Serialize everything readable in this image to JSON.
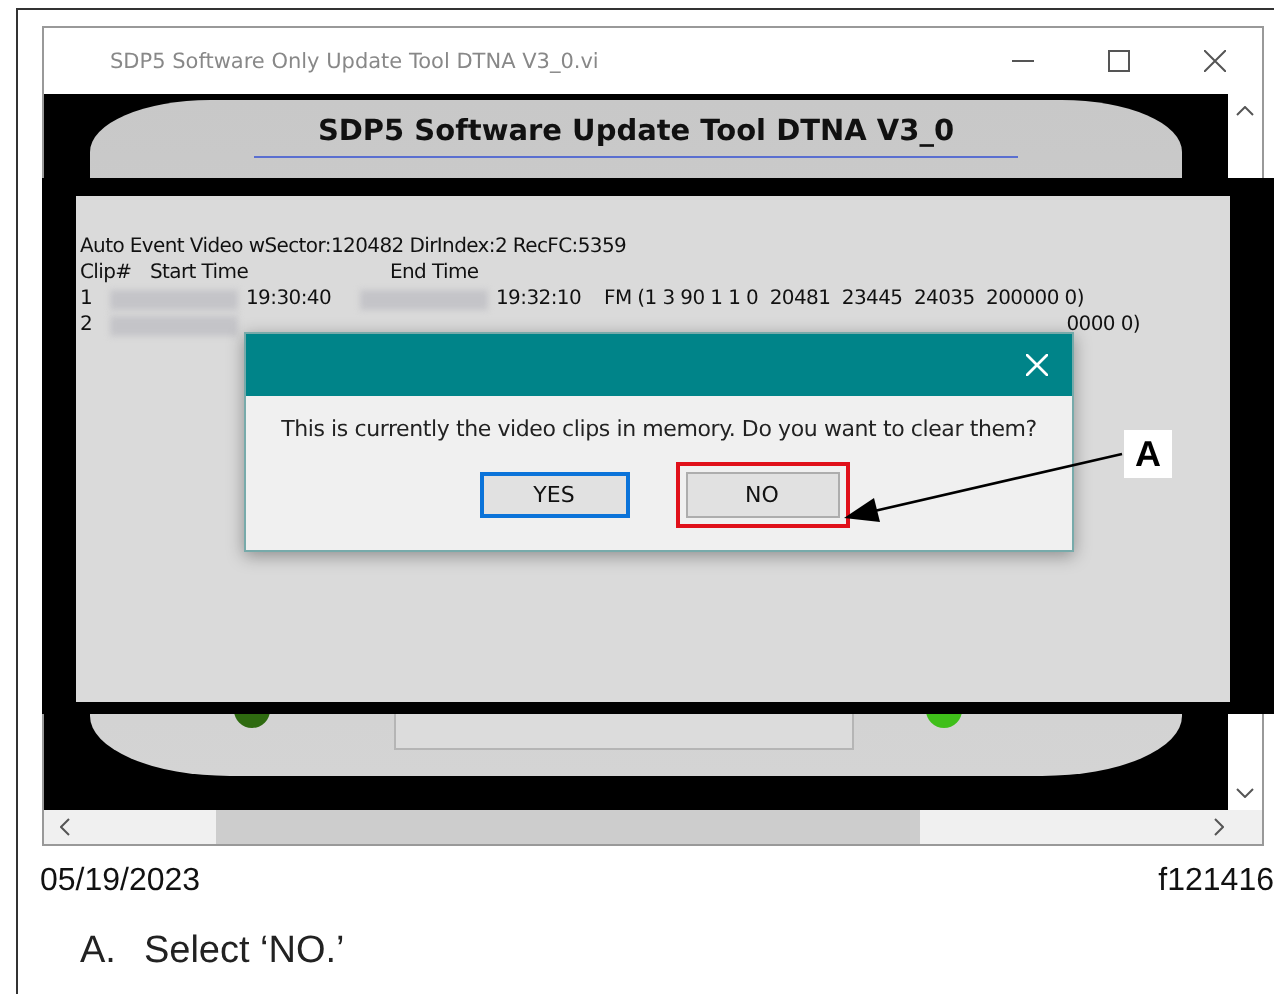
{
  "window": {
    "title": "SDP5 Software Only Update Tool DTNA V3_0.vi"
  },
  "app": {
    "heading": "SDP5 Software Update Tool DTNA V3_0"
  },
  "log": {
    "summary": "Auto Event Video wSector:120482 DirIndex:2 RecFC:5359",
    "columns": [
      "Clip#",
      "Start Time",
      "End Time"
    ],
    "rows": [
      {
        "clip": "1",
        "start_time": "19:30:40",
        "end_time": "19:32:10",
        "info": "FM (1 3 90 1 1 0  20481  23445  24035  200000 0)"
      },
      {
        "clip": "2",
        "info": "0000 0)"
      }
    ]
  },
  "dialog": {
    "message": "This is currently the video clips in memory. Do you want to clear them?",
    "buttons": [
      {
        "label": "YES",
        "focused": true,
        "highlighted": false
      },
      {
        "label": "NO",
        "focused": false,
        "highlighted": true
      }
    ]
  },
  "callout": {
    "label": "A"
  },
  "footer": {
    "date": "05/19/2023",
    "figure_id": "f121416"
  },
  "steps": [
    {
      "marker": "A.",
      "text": "Select ‘NO.’"
    }
  ]
}
